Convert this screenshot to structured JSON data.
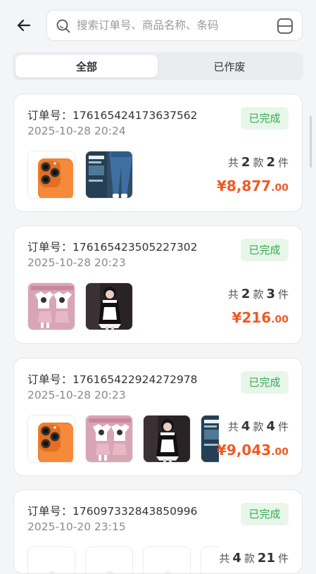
{
  "search": {
    "placeholder": "搜索订单号、商品名称、条码"
  },
  "tabs": [
    {
      "label": "全部"
    },
    {
      "label": "已作废"
    }
  ],
  "orders": [
    {
      "order_label": "订单号：",
      "order_no": "176165424173637562",
      "time": "2025-10-28 20:24",
      "status": "已完成",
      "count_prefix": "共",
      "styles": "2",
      "styles_unit": "款",
      "items": "2",
      "items_unit": "件",
      "price_symbol": "¥",
      "price_int": "8,877",
      "price_dec": ".00"
    },
    {
      "order_label": "订单号：",
      "order_no": "176165423505227302",
      "time": "2025-10-28 20:23",
      "status": "已完成",
      "count_prefix": "共",
      "styles": "2",
      "styles_unit": "款",
      "items": "3",
      "items_unit": "件",
      "price_symbol": "¥",
      "price_int": "216",
      "price_dec": ".00"
    },
    {
      "order_label": "订单号：",
      "order_no": "176165422924272978",
      "time": "2025-10-28 20:23",
      "status": "已完成",
      "count_prefix": "共",
      "styles": "4",
      "styles_unit": "款",
      "items": "4",
      "items_unit": "件",
      "price_symbol": "¥",
      "price_int": "9,043",
      "price_dec": ".00"
    },
    {
      "order_label": "订单号：",
      "order_no": "176097332843850996",
      "time": "2025-10-20 23:15",
      "status": "已完成",
      "count_prefix": "共",
      "styles": "4",
      "styles_unit": "款",
      "items": "21",
      "items_unit": "件"
    }
  ],
  "colors": {
    "accent_price": "#f05a24",
    "status_green": "#3aa655",
    "status_bg": "#e8f6ea"
  },
  "icons": {
    "back": "arrow-left-icon",
    "search": "search-icon",
    "scan": "scan-icon"
  }
}
